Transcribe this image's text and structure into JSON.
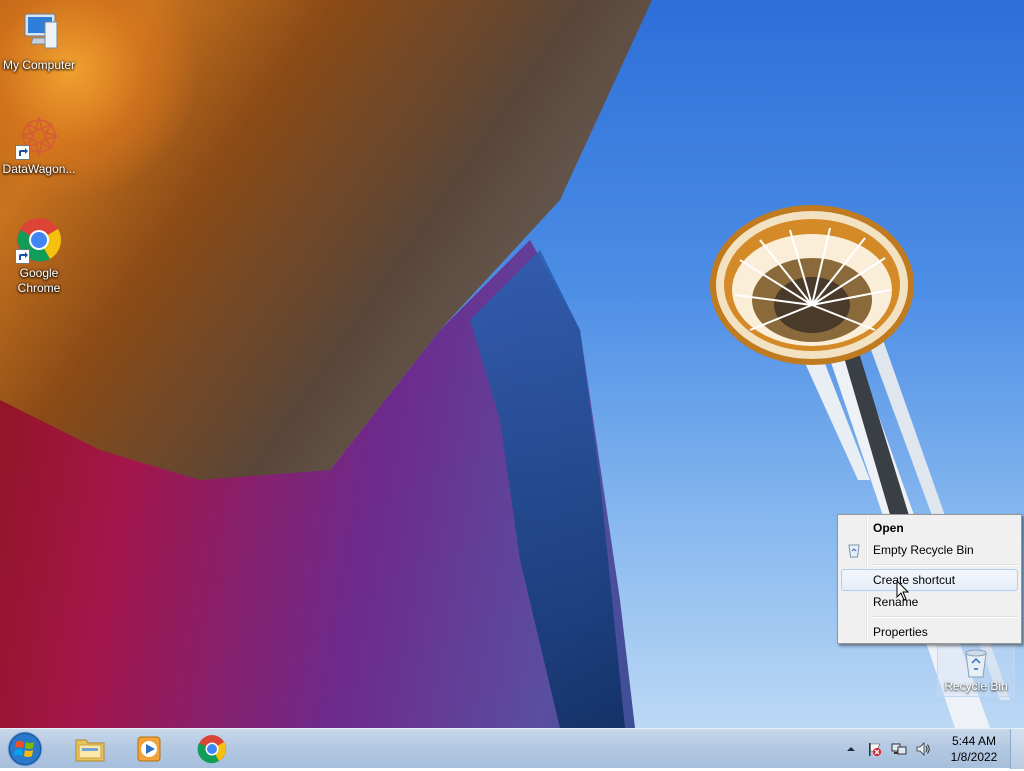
{
  "desktop": {
    "icons": [
      {
        "label": "My Computer",
        "icon": "computer-icon"
      },
      {
        "label": "DataWagon...",
        "icon": "datawagon-icon"
      },
      {
        "label": "Google Chrome",
        "icon": "chrome-icon"
      }
    ],
    "recycle_bin": {
      "label": "Recycle Bin",
      "icon": "recycle-bin-icon"
    }
  },
  "context_menu": {
    "items": [
      {
        "label": "Open",
        "bold": true
      },
      {
        "label": "Empty Recycle Bin",
        "icon": "recycle-bin-small-icon"
      },
      {
        "label": "Create shortcut",
        "hovered": true
      },
      {
        "label": "Rename"
      },
      {
        "label": "Properties"
      }
    ]
  },
  "taskbar": {
    "start": {
      "icon": "windows-start-icon"
    },
    "pinned": [
      {
        "name": "Windows Explorer",
        "icon": "folder-icon"
      },
      {
        "name": "Windows Media Player",
        "icon": "media-player-icon"
      },
      {
        "name": "Google Chrome",
        "icon": "chrome-icon"
      }
    ],
    "tray": {
      "icons": [
        "show-hidden-icons-arrow",
        "action-center-flag-icon",
        "network-icon",
        "volume-icon"
      ],
      "time": "5:44 AM",
      "date": "1/8/2022"
    }
  },
  "colors": {
    "taskbar": "#b4c9e2",
    "menu_bg": "#f0f0f0",
    "menu_hover_border": "#aecff7"
  }
}
